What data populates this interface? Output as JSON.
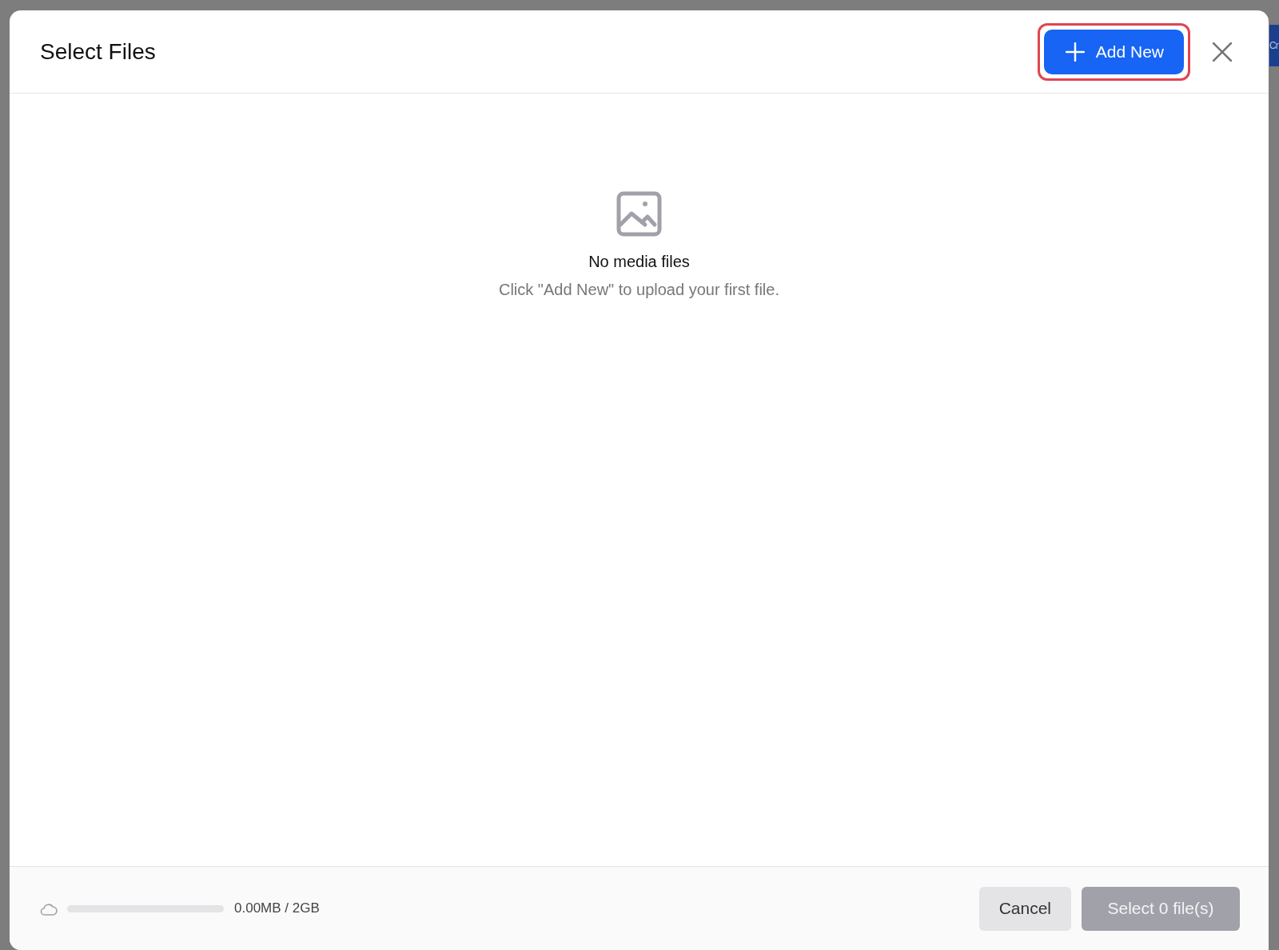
{
  "backdrop": {
    "button_fragment": "Cr"
  },
  "dialog": {
    "title": "Select Files",
    "add_button": {
      "label": "Add New",
      "highlighted": true
    },
    "empty_state": {
      "title": "No media files",
      "message": "Click \"Add New\" to upload your first file."
    },
    "storage": {
      "level": 0,
      "reading": "0.00MB / 2GB"
    },
    "buttons": [
      {
        "kind": "secondary",
        "label": "Cancel",
        "disabled": false
      },
      {
        "kind": "primary",
        "label": "Select 0 file(s)",
        "disabled": true
      }
    ]
  }
}
